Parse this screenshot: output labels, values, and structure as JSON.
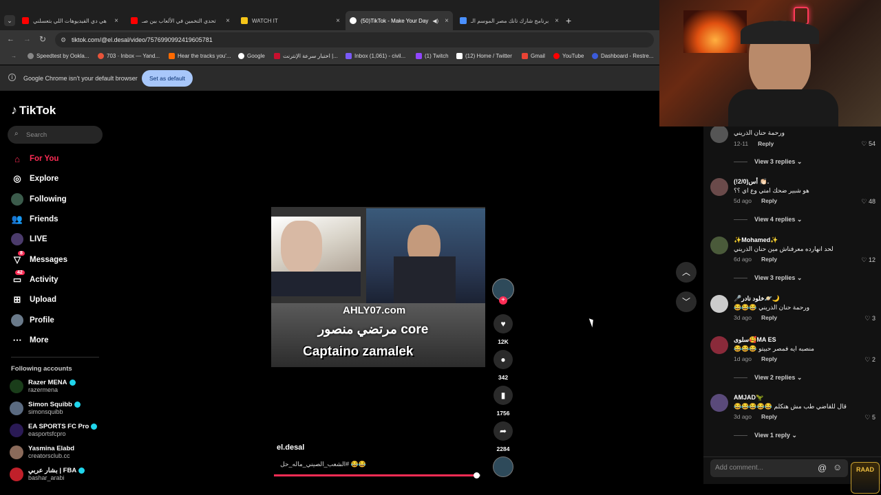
{
  "browser": {
    "tabs": [
      {
        "title": "هي دي الفيديوهات اللي بتعسلني",
        "color": "#ff0000"
      },
      {
        "title": "تحدي التخمين في الألعاب بين صـ",
        "color": "#ff0000"
      },
      {
        "title": "WATCH IT",
        "color": "#f5c518"
      },
      {
        "title": "(50)TikTok - Make Your Day",
        "color": "#ffffff"
      },
      {
        "title": "برنامج شارك تانك مصر الموسم الـ",
        "color": "#4a90ff"
      }
    ],
    "new_tab": "+",
    "tab_close": "×",
    "url": "tiktok.com/@el.desal/video/7576990992419605781",
    "bookmarks": [
      "Speedtest by Ookla...",
      "703 · Inbox — Yand...",
      "Hear the tracks you'...",
      "Google",
      "اختبار سرعة الإنترنت |...",
      "Inbox (1,061) - civil...",
      "(1) Twitch",
      "(12) Home / Twitter",
      "Gmail",
      "YouTube",
      "Dashboard - Restre..."
    ],
    "infobar_text": "Google Chrome isn't your default browser",
    "set_default_label": "Set as default"
  },
  "sidebar": {
    "logo": "TikTok",
    "search_placeholder": "Search",
    "nav": [
      {
        "label": "For You",
        "icon": "home-icon",
        "active": true
      },
      {
        "label": "Explore",
        "icon": "compass-icon"
      },
      {
        "label": "Following",
        "icon": "following-avatar-icon"
      },
      {
        "label": "Friends",
        "icon": "friends-icon"
      },
      {
        "label": "LIVE",
        "icon": "live-icon"
      },
      {
        "label": "Messages",
        "icon": "messages-icon",
        "badge": "8"
      },
      {
        "label": "Activity",
        "icon": "activity-icon",
        "badge": "42"
      },
      {
        "label": "Upload",
        "icon": "upload-icon"
      },
      {
        "label": "Profile",
        "icon": "profile-avatar-icon"
      },
      {
        "label": "More",
        "icon": "more-icon"
      }
    ],
    "following_header": "Following accounts",
    "accounts": [
      {
        "name": "Razer MENA",
        "handle": "razermena",
        "verified": true,
        "color": "#1a3d1a"
      },
      {
        "name": "Simon Squibb",
        "handle": "simonsquibb",
        "verified": true,
        "color": "#5a6a80"
      },
      {
        "name": "EA SPORTS FC Pro",
        "handle": "easportsfcpro",
        "verified": true,
        "color": "#2a1a55"
      },
      {
        "name": "Yasmina Elabd",
        "handle": "creatorsclub.cc",
        "verified": false,
        "color": "#8a6a5a"
      },
      {
        "name": "بشار عربي | FBA",
        "handle": "bashar_arabi",
        "verified": true,
        "color": "#c0202a"
      }
    ]
  },
  "video": {
    "overlay_site": "AHLY07.com",
    "overlay_arabic": "مرتضي منصور core",
    "overlay_caption": "Captaino zamalek",
    "author": "el.desal",
    "description": "😂😂 #الشعب_الصيني_ماله_حل",
    "progress": 0.98
  },
  "actions": {
    "likes": "12K",
    "comments": "342",
    "saves": "1756",
    "shares": "2284"
  },
  "comments": [
    {
      "user": "",
      "text": "ورحمة حنان الذريني",
      "date": "12-11",
      "likes": "54",
      "views": "View 3 replies"
    },
    {
      "user": "أس(2/0!) 👏🏻.",
      "text": "هو شبير ضحك امتي وع اي ؟؟",
      "date": "5d ago",
      "likes": "48",
      "views": "View 4 replies"
    },
    {
      "user": "✨Mohamed✨",
      "text": "لحد انهارده معرفناش مين حنان الذريني",
      "date": "6d ago",
      "likes": "12",
      "views": "View 3 replies"
    },
    {
      "user": "🎤خلود نادر🪐🌙",
      "text": "😂😂😂 ورحمة حنان الذريني",
      "date": "3d ago",
      "likes": "3",
      "views": ""
    },
    {
      "user": "سلوى🥰MA ES",
      "text": "😂😂😂 منصبه ايه فمصر حبيتو",
      "date": "1d ago",
      "likes": "2",
      "views": "View 2 replies"
    },
    {
      "user": "AMJAD🦖",
      "text": "😂😂😂😂😂 قال للقاضي طب مش هتكلم",
      "date": "3d ago",
      "likes": "5",
      "views": "View 1 reply"
    }
  ],
  "reply_label": "Reply",
  "add_comment_placeholder": "Add comment...",
  "stream_overlay_badge": "RAAD"
}
